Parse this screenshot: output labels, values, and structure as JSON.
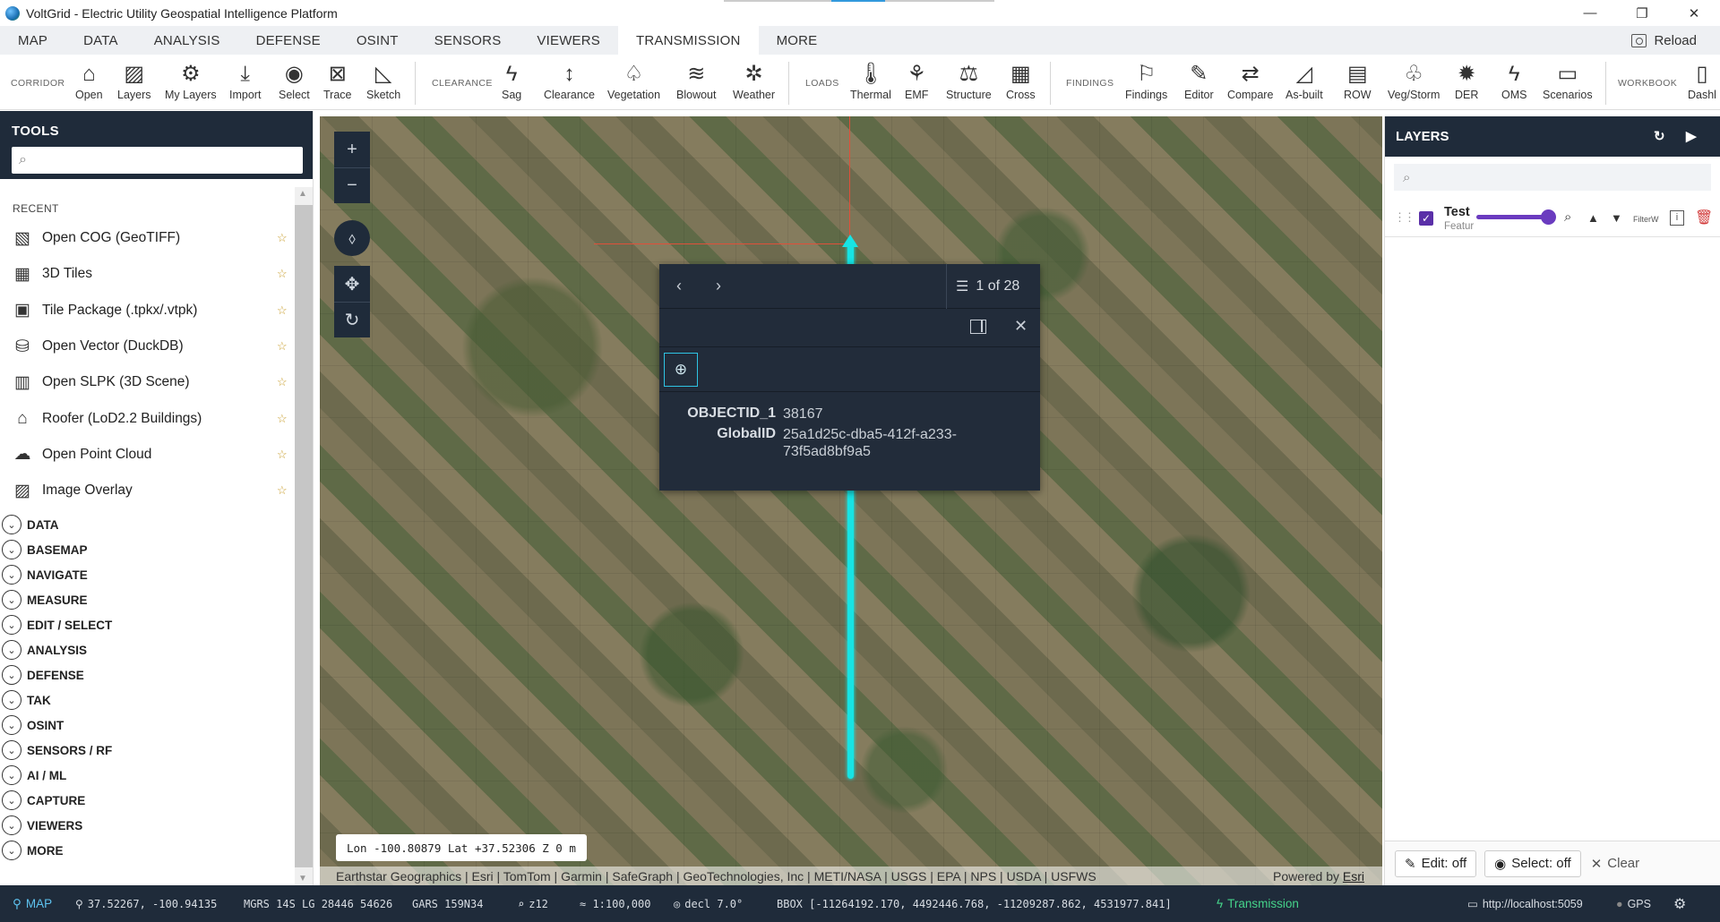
{
  "titlebar": {
    "title": "VoltGrid - Electric Utility Geospatial Intelligence Platform",
    "minimize": "—",
    "restore": "❐",
    "close": "✕"
  },
  "menubar": {
    "items": [
      "MAP",
      "DATA",
      "ANALYSIS",
      "DEFENSE",
      "OSINT",
      "SENSORS",
      "VIEWERS",
      "TRANSMISSION",
      "MORE"
    ],
    "active": "TRANSMISSION",
    "reload": "Reload"
  },
  "ribbon": {
    "groups": {
      "corridor": "CORRIDOR",
      "clearance": "CLEARANCE",
      "loads": "LOADS",
      "findings": "FINDINGS",
      "workbook": "WORKBOOK"
    },
    "buttons": {
      "open": "Open",
      "layers": "Layers",
      "my_layers": "My Layers",
      "import": "Import",
      "select": "Select",
      "trace": "Trace",
      "sketch": "Sketch",
      "sag": "Sag",
      "clearance": "Clearance",
      "vegetation": "Vegetation",
      "blowout": "Blowout",
      "weather": "Weather",
      "thermal": "Thermal",
      "emf": "EMF",
      "structure": "Structure",
      "cross": "Cross",
      "findings": "Findings",
      "editor": "Editor",
      "compare": "Compare",
      "as_built": "As-built",
      "row": "ROW",
      "veg_storm": "Veg/Storm",
      "der": "DER",
      "oms": "OMS",
      "scenarios": "Scenarios",
      "dashb": "Dashl"
    }
  },
  "tools": {
    "title": "TOOLS",
    "search_placeholder": "",
    "recent_label": "RECENT",
    "recent": [
      {
        "label": "Open COG (GeoTIFF)",
        "icon": "geotiff-icon",
        "glyph": "▧"
      },
      {
        "label": "3D Tiles",
        "icon": "tiles-3d-icon",
        "glyph": "▦"
      },
      {
        "label": "Tile Package (.tpkx/.vtpk)",
        "icon": "tile-package-icon",
        "glyph": "▣"
      },
      {
        "label": "Open Vector (DuckDB)",
        "icon": "database-icon",
        "glyph": "⛁"
      },
      {
        "label": "Open SLPK (3D Scene)",
        "icon": "scene-icon",
        "glyph": "▥"
      },
      {
        "label": "Roofer (LoD2.2 Buildings)",
        "icon": "building-icon",
        "glyph": "⌂"
      },
      {
        "label": "Open Point Cloud",
        "icon": "cloud-icon",
        "glyph": "☁"
      },
      {
        "label": "Image Overlay",
        "icon": "image-overlay-icon",
        "glyph": "▨"
      }
    ],
    "sections": [
      "DATA",
      "BASEMAP",
      "NAVIGATE",
      "MEASURE",
      "EDIT / SELECT",
      "ANALYSIS",
      "DEFENSE",
      "TAK",
      "OSINT",
      "SENSORS / RF",
      "AI / ML",
      "CAPTURE",
      "VIEWERS",
      "MORE"
    ]
  },
  "popup": {
    "count": "1 of 28",
    "attributes": [
      {
        "key": "OBJECTID_1",
        "value": "38167"
      },
      {
        "key": "GlobalID",
        "value": "25a1d25c-dba5-412f-a233-73f5ad8bf9a5"
      }
    ]
  },
  "map": {
    "coords": "Lon -100.80879  Lat +37.52306  Z 0 m",
    "attribution": "Earthstar Geographics | Esri | TomTom | Garmin | SafeGraph | GeoTechnologies, Inc | METI/NASA | USGS | EPA | NPS | USDA | USFWS",
    "powered_by": "Powered by",
    "esri": "Esri"
  },
  "layers": {
    "title": "LAYERS",
    "search_placeholder": "",
    "items": [
      {
        "name": "Test",
        "type": "Featur",
        "filter_label": "FilterW",
        "visible": true,
        "opacity": 1.0
      }
    ],
    "edit": "Edit: off",
    "select": "Select: off",
    "clear": "Clear"
  },
  "status": {
    "mode": "MAP",
    "latlon": "37.52267, -100.94135",
    "mgrs": "MGRS 14S LG 28446 54626",
    "gars": "GARS 159N34",
    "zoom": "z12",
    "scale": "≈ 1:100,000",
    "decl": "decl 7.0°",
    "bbox": "BBOX [-11264192.170, 4492446.768, -11209287.862, 4531977.841]",
    "transmission": "Transmission",
    "url": "http://localhost:5059",
    "gps": "GPS"
  }
}
